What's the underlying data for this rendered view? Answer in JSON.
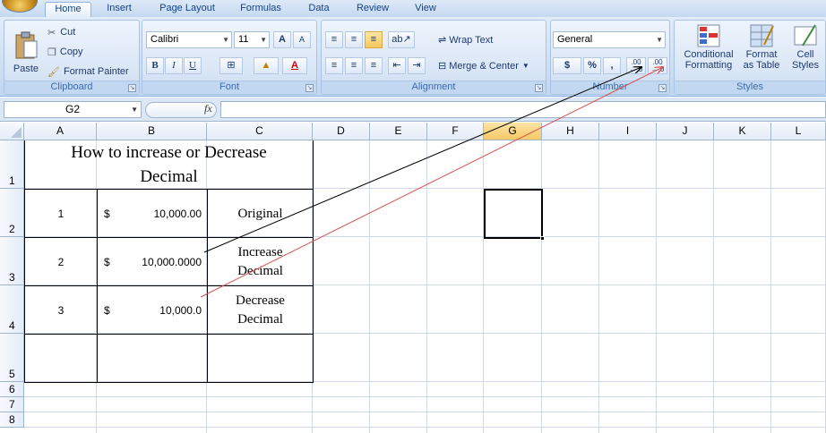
{
  "tabs": [
    "Home",
    "Insert",
    "Page Layout",
    "Formulas",
    "Data",
    "Review",
    "View"
  ],
  "clipboard": {
    "paste": "Paste",
    "cut": "Cut",
    "copy": "Copy",
    "format_painter": "Format Painter",
    "label": "Clipboard"
  },
  "font": {
    "name": "Calibri",
    "size": "11",
    "bold": "B",
    "italic": "I",
    "underline": "U",
    "grow": "A",
    "shrink": "A",
    "label": "Font"
  },
  "alignment": {
    "wrap": "Wrap Text",
    "merge": "Merge & Center",
    "label": "Alignment"
  },
  "number": {
    "format": "General",
    "currency": "$",
    "percent": "%",
    "comma": ",",
    "inc_dec": ".00 ←.0",
    "dec_dec": ".00 →.0",
    "label": "Number"
  },
  "styles": {
    "conditional": "Conditional",
    "conditional2": "Formatting",
    "format_table": "Format",
    "format_table2": "as Table",
    "cell_styles": "Cell",
    "cell_styles2": "Styles",
    "label": "Styles"
  },
  "formula_bar": {
    "name_box": "G2",
    "fx": "fx",
    "value": ""
  },
  "columns": [
    "A",
    "B",
    "C",
    "D",
    "E",
    "F",
    "G",
    "H",
    "I",
    "J",
    "K",
    "L"
  ],
  "selected_column": "G",
  "rows": [
    "1",
    "2",
    "3",
    "4",
    "5",
    "6",
    "7",
    "8"
  ],
  "sheet": {
    "title_line1": "How to increase or Decrease",
    "title_line2": "Decimal",
    "r2": {
      "a": "1",
      "cur": "$",
      "b": "10,000.00",
      "c": "Original"
    },
    "r3": {
      "a": "2",
      "cur": "$",
      "b": "10,000.0000",
      "c1": "Increase",
      "c2": "Decimal"
    },
    "r4": {
      "a": "3",
      "cur": "$",
      "b": "10,000.0",
      "c1": "Decrease",
      "c2": "Decimal"
    }
  },
  "colors": {
    "ribbon": "#cfdff3",
    "arrow_black": "#000000",
    "arrow_red": "#d9534f",
    "selection": "#000000"
  }
}
